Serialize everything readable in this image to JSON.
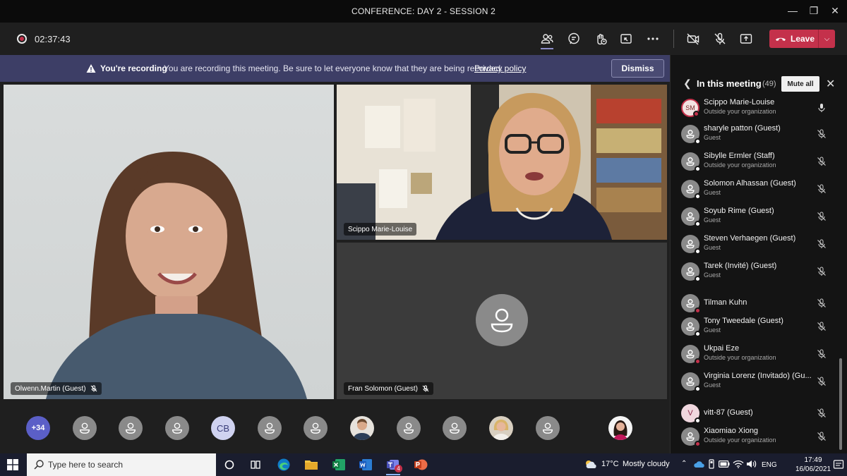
{
  "window": {
    "title": "CONFERENCE: DAY 2 - SESSION 2"
  },
  "toolbar": {
    "recording_time": "02:37:43",
    "icons": [
      "participants-icon",
      "chat-icon",
      "reactions-icon",
      "share-tray-icon",
      "more-icon",
      "camera-off-icon",
      "mic-off-icon",
      "share-icon"
    ],
    "leave_label": "Leave",
    "leave_color": "#c4314b"
  },
  "banner": {
    "strong": "You're recording",
    "message": "You are recording this meeting. Be sure to let everyone know that they are being recorded.",
    "link": "Privacy policy",
    "dismiss_label": "Dismiss",
    "bg_color": "#3d3e66"
  },
  "stage": {
    "tiles": [
      {
        "label": "Olwenn.Martin (Guest)",
        "muted": true
      },
      {
        "label": "Scippo Marie-Louise",
        "muted": false
      },
      {
        "label": "Fran Solomon (Guest)",
        "muted": true
      }
    ]
  },
  "strip": {
    "overflow_count": "+34",
    "initials_cb": "CB"
  },
  "panel": {
    "title": "In this meeting",
    "count": "(49)",
    "mute_all_label": "Mute all",
    "participants": [
      {
        "name": "Scippo Marie-Louise",
        "sub": "Outside your organization",
        "status": "#c4314b",
        "mic": "on"
      },
      {
        "name": "sharyle patton (Guest)",
        "sub": "Guest",
        "status": "#ffffff",
        "mic": "off"
      },
      {
        "name": "Sibylle Ermler (Staff)",
        "sub": "Outside your organization",
        "status": "#ffffff",
        "mic": "off"
      },
      {
        "name": "Solomon Alhassan (Guest)",
        "sub": "Guest",
        "status": "#ffffff",
        "mic": "off"
      },
      {
        "name": "Soyub Rime (Guest)",
        "sub": "Guest",
        "status": "#ffffff",
        "mic": "off"
      },
      {
        "name": "Steven Verhaegen (Guest)",
        "sub": "Guest",
        "status": "#ffffff",
        "mic": "off"
      },
      {
        "name": "Tarek (Invité) (Guest)",
        "sub": "Guest",
        "status": "#ffffff",
        "mic": "off"
      },
      {
        "name": "Tilman Kuhn",
        "sub": "",
        "status": "#c4314b",
        "mic": "off"
      },
      {
        "name": "Tony Tweedale (Guest)",
        "sub": "Guest",
        "status": "#ffffff",
        "mic": "off"
      },
      {
        "name": "Ukpai Eze",
        "sub": "Outside your organization",
        "status": "#c4314b",
        "mic": "off"
      },
      {
        "name": "Virginia Lorenz (Invitado) (Gu...",
        "sub": "Guest",
        "status": "#ffffff",
        "mic": "off"
      },
      {
        "name": "vitt-87 (Guest)",
        "sub": "",
        "status": "#ffffff",
        "mic": "off"
      },
      {
        "name": "Xiaomiao Xiong",
        "sub": "Outside your organization",
        "status": "#c4314b",
        "mic": "off"
      }
    ]
  },
  "taskbar": {
    "search_placeholder": "Type here to search",
    "weather_temp": "17°C",
    "weather_desc": "Mostly cloudy",
    "language": "ENG",
    "time": "17:49",
    "date": "16/06/2021",
    "teams_badge": "4"
  }
}
